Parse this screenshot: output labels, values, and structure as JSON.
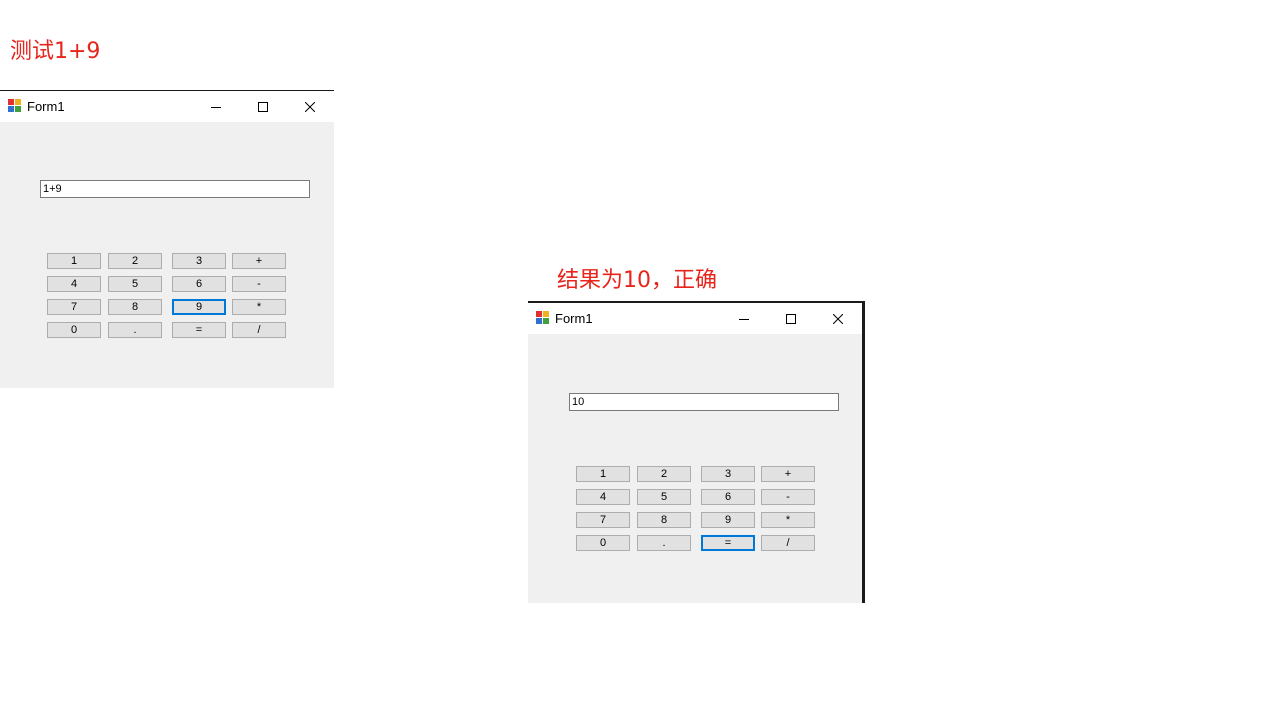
{
  "captions": {
    "test": "测试1+9",
    "result": "结果为10，正确"
  },
  "windows": [
    {
      "title": "Form1",
      "display_value": "1+9",
      "focused_key": "9",
      "controls": {
        "minimize_icon": "minimize-icon",
        "maximize_icon": "maximize-icon",
        "close_icon": "close-icon"
      }
    },
    {
      "title": "Form1",
      "display_value": "10",
      "focused_key": "=",
      "controls": {
        "minimize_icon": "minimize-icon",
        "maximize_icon": "maximize-icon",
        "close_icon": "close-icon"
      }
    }
  ],
  "keypad": [
    [
      "1",
      "2",
      "3",
      "+"
    ],
    [
      "4",
      "5",
      "6",
      "-"
    ],
    [
      "7",
      "8",
      "9",
      "*"
    ],
    [
      "0",
      ".",
      "=",
      "/"
    ]
  ],
  "colors": {
    "caption": "#e8241c",
    "window_bg": "#f0f0f0",
    "key_bg": "#e1e1e1",
    "focus_border": "#0078d7"
  }
}
